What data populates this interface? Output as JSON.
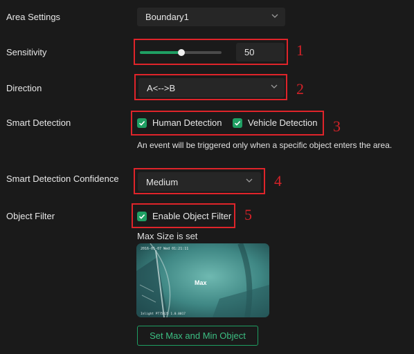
{
  "area_settings": {
    "label": "Area Settings",
    "value": "Boundary1"
  },
  "sensitivity": {
    "label": "Sensitivity",
    "value": "50",
    "level": 0.5
  },
  "direction": {
    "label": "Direction",
    "value": "A<-->B"
  },
  "smart_detection": {
    "label": "Smart Detection",
    "options": [
      {
        "label": "Human Detection",
        "checked": true
      },
      {
        "label": "Vehicle Detection",
        "checked": true
      }
    ],
    "note": "An event will be triggered only when a specific object enters the area."
  },
  "confidence": {
    "label": "Smart Detection Confidence",
    "value": "Medium"
  },
  "object_filter": {
    "label": "Object Filter",
    "checkbox_label": "Enable Object Filter",
    "checked": true,
    "status": "Max Size is set",
    "preview": {
      "overlay_label": "Max",
      "timestamp": "2016-01-07 Wed 01:21:11",
      "caption": "Inlight PT75425 1.0.0017"
    },
    "button_label": "Set Max and Min Object"
  },
  "markers": [
    "1",
    "2",
    "3",
    "4",
    "5"
  ],
  "colors": {
    "accent": "#1f9f63",
    "highlight": "#e0242a",
    "background": "#1a1a1a"
  }
}
